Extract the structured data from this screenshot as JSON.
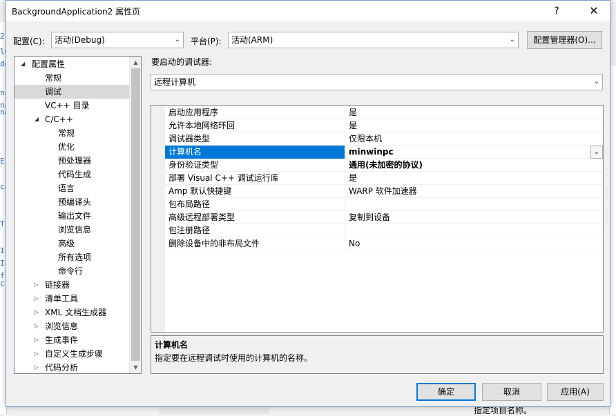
{
  "background": {
    "left_fragments": [
      "2",
      "le",
      "de",
      "na",
      "na",
      "na",
      "E",
      "ca",
      "T",
      "I",
      "I",
      "f",
      "c"
    ],
    "bottom_text": "指定项目名称。"
  },
  "dialog": {
    "title": "BackgroundApplication2 属性页",
    "help": "?",
    "close": "✕"
  },
  "config": {
    "label": "配置(C):",
    "value": "活动(Debug)",
    "platform_label": "平台(P):",
    "platform_value": "活动(ARM)",
    "manager_button": "配置管理器(O)..."
  },
  "tree": {
    "items": [
      {
        "label": "配置属性",
        "expander": "◢"
      },
      {
        "label": "常规"
      },
      {
        "label": "调试"
      },
      {
        "label": "VC++ 目录"
      },
      {
        "label": "C/C++",
        "expander": "◢"
      },
      {
        "label": "常规"
      },
      {
        "label": "优化"
      },
      {
        "label": "预处理器"
      },
      {
        "label": "代码生成"
      },
      {
        "label": "语言"
      },
      {
        "label": "预编译头"
      },
      {
        "label": "输出文件"
      },
      {
        "label": "浏览信息"
      },
      {
        "label": "高级"
      },
      {
        "label": "所有选项"
      },
      {
        "label": "命令行"
      },
      {
        "label": "链接器",
        "expander": "▷"
      },
      {
        "label": "清单工具",
        "expander": "▷"
      },
      {
        "label": "XML 文档生成器",
        "expander": "▷"
      },
      {
        "label": "浏览信息",
        "expander": "▷"
      },
      {
        "label": "生成事件",
        "expander": "▷"
      },
      {
        "label": "自定义生成步骤",
        "expander": "▷"
      },
      {
        "label": "代码分析",
        "expander": "▷"
      }
    ],
    "selected": "调试"
  },
  "debugger": {
    "label": "要启动的调试器:",
    "value": "远程计算机"
  },
  "properties": [
    {
      "name": "启动应用程序",
      "value": "是"
    },
    {
      "name": "允许本地网络环回",
      "value": "是"
    },
    {
      "name": "调试器类型",
      "value": "仅限本机"
    },
    {
      "name": "计算机名",
      "value": "minwinpc"
    },
    {
      "name": "身份验证类型",
      "value": "通用(未加密的协议)"
    },
    {
      "name": "部署 Visual C++ 调试运行库",
      "value": "是"
    },
    {
      "name": "Amp 默认快捷键",
      "value": "WARP 软件加速器"
    },
    {
      "name": "包布局路径",
      "value": ""
    },
    {
      "name": "高级远程部署类型",
      "value": "复制到设备"
    },
    {
      "name": "包注册路径",
      "value": ""
    },
    {
      "name": "删除设备中的非布局文件",
      "value": "No"
    }
  ],
  "selected_property": "计算机名",
  "description": {
    "title": "计算机名",
    "text": "指定要在远程调试时使用的计算机的名称。"
  },
  "buttons": {
    "ok": "确定",
    "cancel": "取消",
    "apply": "应用(A)"
  },
  "colors": {
    "accent": "#0078d7",
    "tree_selected": "#d9d9d9"
  }
}
